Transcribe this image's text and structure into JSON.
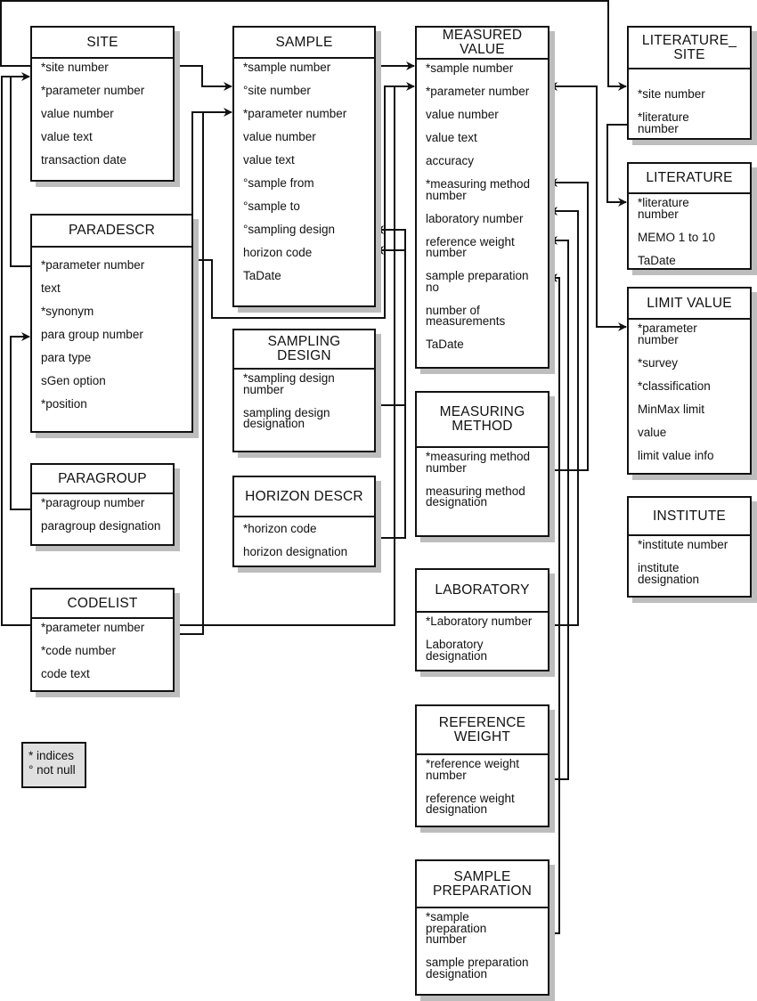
{
  "tables": {
    "site": {
      "title": "SITE",
      "rows": [
        "*site number",
        "*parameter number",
        "value number",
        "value text",
        "transaction date"
      ]
    },
    "sample": {
      "title": "SAMPLE",
      "rows": [
        "*sample number",
        "°site number",
        "*parameter number",
        "value number",
        "value text",
        "°sample from",
        "°sample to",
        "°sampling design",
        "horizon code",
        "TaDate"
      ]
    },
    "measured_value": {
      "title": "MEASURED\nVALUE",
      "rows": [
        "*sample number",
        "*parameter number",
        "value number",
        "value text",
        "accuracy",
        "*measuring method\nnumber",
        "laboratory number",
        "reference weight\nnumber",
        "sample preparation\nno",
        "number of\nmeasurements",
        "TaDate"
      ]
    },
    "literature_site": {
      "title": "LITERATURE_\nSITE",
      "rows": [
        "*site number",
        "*literature\nnumber"
      ]
    },
    "literature": {
      "title": "LITERATURE",
      "rows": [
        "*literature\nnumber",
        "MEMO 1 to 10",
        "TaDate"
      ]
    },
    "limit_value": {
      "title": "LIMIT VALUE",
      "rows": [
        "*parameter\nnumber",
        "*survey",
        "*classification",
        "MinMax limit",
        "value",
        "limit value info"
      ]
    },
    "institute": {
      "title": "INSTITUTE",
      "rows": [
        "*institute number",
        "institute\ndesignation"
      ]
    },
    "paradescr": {
      "title": "PARADESCR",
      "rows": [
        "*parameter number",
        "text",
        "*synonym",
        "para group number",
        "para type",
        "sGen option",
        "*position"
      ]
    },
    "sampling_design": {
      "title": "SAMPLING\nDESIGN",
      "rows": [
        "*sampling design\nnumber",
        "sampling design\ndesignation"
      ]
    },
    "horizon_descr": {
      "title": "HORIZON DESCR",
      "rows": [
        "*horizon code",
        "horizon designation"
      ]
    },
    "paragroup": {
      "title": "PARAGROUP",
      "rows": [
        "*paragroup number",
        "paragroup designation"
      ]
    },
    "codelist": {
      "title": "CODELIST",
      "rows": [
        "*parameter number",
        "*code number",
        "code text"
      ]
    },
    "measuring_method": {
      "title": "MEASURING\nMETHOD",
      "rows": [
        "*measuring method\nnumber",
        "measuring method\ndesignation"
      ]
    },
    "laboratory": {
      "title": "LABORATORY",
      "rows": [
        "*Laboratory number",
        "Laboratory\ndesignation"
      ]
    },
    "reference_weight": {
      "title": "REFERENCE\nWEIGHT",
      "rows": [
        "*reference weight\nnumber",
        "reference weight\ndesignation"
      ]
    },
    "sample_preparation": {
      "title": "SAMPLE\nPREPARATION",
      "rows": [
        "*sample\npreparation\nnumber",
        "sample preparation\ndesignation"
      ]
    }
  },
  "legend": {
    "indices": "* indices",
    "not_null": "° not null"
  },
  "colors": {
    "line": "#111111",
    "shadow": "#bdbdbd",
    "legend_bg": "#e0e0e0"
  }
}
